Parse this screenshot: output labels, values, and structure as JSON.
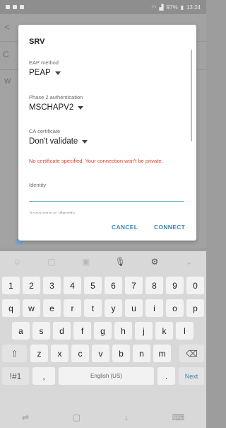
{
  "status_bar": {
    "time": "13:24",
    "battery": "97%"
  },
  "background": {
    "back_glyph": "<",
    "row_c": "C",
    "row_w": "W"
  },
  "dialog": {
    "title": "SRV",
    "eap_label": "EAP method",
    "eap_value": "PEAP",
    "phase2_label": "Phase 2 authentication",
    "phase2_value": "MSCHAPV2",
    "ca_label": "CA certificate",
    "ca_value": "Don't validate",
    "warning": "No certificate specified. Your connection won't be private.",
    "identity_label": "Identity",
    "identity_value": "",
    "anonymous_label": "Anonymous identity",
    "cancel": "CANCEL",
    "connect": "CONNECT"
  },
  "keyboard": {
    "toolbar_icons": [
      "emoji-icon",
      "sticker-icon",
      "gif-icon",
      "mic-icon",
      "settings-icon",
      "collapse-icon"
    ],
    "row1": [
      "1",
      "2",
      "3",
      "4",
      "5",
      "6",
      "7",
      "8",
      "9",
      "0"
    ],
    "row2": [
      "q",
      "w",
      "e",
      "r",
      "t",
      "y",
      "u",
      "i",
      "o",
      "p"
    ],
    "row3": [
      "a",
      "s",
      "d",
      "f",
      "g",
      "h",
      "j",
      "k",
      "l"
    ],
    "row4": [
      "z",
      "x",
      "c",
      "v",
      "b",
      "n",
      "m"
    ],
    "symbols": "!#1",
    "comma": ",",
    "space": "English (US)",
    "period": ".",
    "next": "Next"
  },
  "colors": {
    "accent": "#3d84b2",
    "warning": "#e0412c"
  }
}
